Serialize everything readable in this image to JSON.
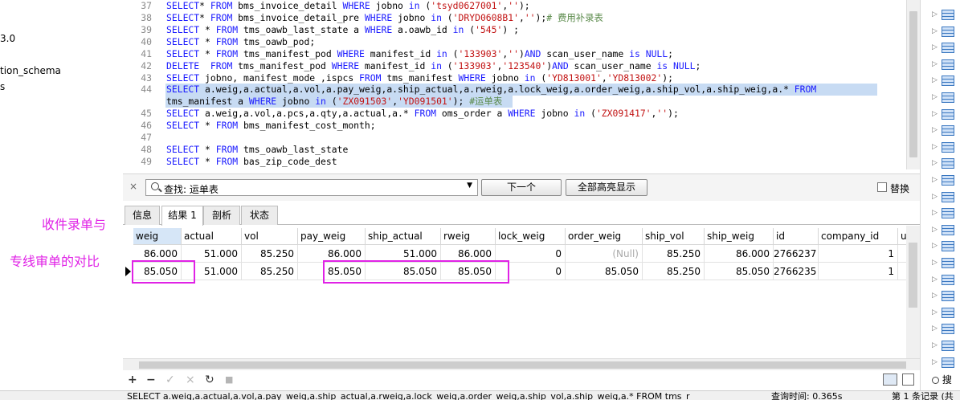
{
  "left_panel": {
    "items": [
      "3.0",
      "tion_schema",
      "s"
    ]
  },
  "annotations": {
    "line1": "收件录单与",
    "line2": "专线审单的对比"
  },
  "editor": {
    "lines": [
      {
        "no": "37",
        "html": "<span class=\"kw\">SELECT</span>* <span class=\"kw\">FROM</span> bms_invoice_detail <span class=\"kw\">WHERE</span> jobno <span class=\"kw\">in</span> (<span class=\"str\">'tsyd0627001'</span>,<span class=\"str\">''</span>);"
      },
      {
        "no": "38",
        "html": "<span class=\"kw\">SELECT</span>* <span class=\"kw\">FROM</span> bms_invoice_detail_pre <span class=\"kw\">WHERE</span> jobno <span class=\"kw\">in</span> (<span class=\"str\">'DRYD0608B1'</span>,<span class=\"str\">''</span>);<span class=\"cmt\"># 费用补录表</span>"
      },
      {
        "no": "39",
        "html": "<span class=\"kw\">SELECT</span> * <span class=\"kw\">FROM</span> tms_oawb_last_state a <span class=\"kw\">WHERE</span> a.oawb_id <span class=\"kw\">in</span> (<span class=\"str\">'545'</span>) ;"
      },
      {
        "no": "40",
        "html": "<span class=\"kw\">SELECT</span> * <span class=\"kw\">FROM</span> tms_oawb_pod;"
      },
      {
        "no": "41",
        "html": "<span class=\"kw\">SELECT</span> * <span class=\"kw\">FROM</span> tms_manifest_pod <span class=\"kw\">WHERE</span> manifest_id <span class=\"kw\">in</span> (<span class=\"str\">'133903'</span>,<span class=\"str\">''</span>)<span class=\"kw\">AND</span> scan_user_name <span class=\"kw\">is</span> <span class=\"kw\">NULL</span>;"
      },
      {
        "no": "42",
        "html": "<span class=\"kw\">DELETE</span>  <span class=\"kw\">FROM</span> tms_manifest_pod <span class=\"kw\">WHERE</span> manifest_id <span class=\"kw\">in</span> (<span class=\"str\">'133903'</span>,<span class=\"str\">'123540'</span>)<span class=\"kw\">AND</span> scan_user_name <span class=\"kw\">is</span> <span class=\"kw\">NULL</span>;"
      },
      {
        "no": "43",
        "html": "<span class=\"kw\">SELECT</span> jobno, manifest_mode ,ispcs <span class=\"kw\">FROM</span> tms_manifest <span class=\"kw\">WHERE</span> jobno <span class=\"kw\">in</span> (<span class=\"str\">'YD813001'</span>,<span class=\"str\">'YD813002'</span>);"
      },
      {
        "no": "44",
        "html": "<span class=\"kw\">SELECT</span> a.weig,a.actual,a.vol,a.pay_weig,a.ship_actual,a.rweig,a.lock_weig,a.order_weig,a.ship_vol,a.ship_weig,a.* <span class=\"kw\">FROM</span>"
      },
      {
        "no": "",
        "html": "tms_manifest a <span class=\"kw\">WHERE</span> jobno <span class=\"kw\">in</span> (<span class=\"str\">'ZX091503'</span>,<span class=\"str\">'YD091501'</span>); <span class=\"cmt\">#运单表</span>"
      },
      {
        "no": "45",
        "html": "<span class=\"kw\">SELECT</span> a.weig,a.vol,a.pcs,a.qty,a.actual,a.* <span class=\"kw\">FROM</span> oms_order a <span class=\"kw\">WHERE</span> jobno <span class=\"kw\">in</span> (<span class=\"str\">'ZX091417'</span>,<span class=\"str\">''</span>);"
      },
      {
        "no": "46",
        "html": "<span class=\"kw\">SELECT</span> * <span class=\"kw\">FROM</span> bms_manifest_cost_month;"
      },
      {
        "no": "47",
        "html": ""
      },
      {
        "no": "48",
        "html": "<span class=\"kw\">SELECT</span> * <span class=\"kw\">FROM</span> tms_oawb_last_state"
      },
      {
        "no": "49",
        "html": "<span class=\"kw\">SELECT</span> * <span class=\"kw\">FROM</span> bas_zip_code_dest"
      }
    ]
  },
  "findbar": {
    "close": "×",
    "query": "查找: 运单表",
    "next_label": "下一个",
    "highlight_all_label": "全部高亮显示",
    "replace_label": "替换"
  },
  "tabs": [
    "信息",
    "结果 1",
    "剖析",
    "状态"
  ],
  "grid": {
    "columns": [
      "weig",
      "actual",
      "vol",
      "pay_weig",
      "ship_actual",
      "rweig",
      "lock_weig",
      "order_weig",
      "ship_vol",
      "ship_weig",
      "id",
      "company_id",
      "u"
    ],
    "rows": [
      [
        "86.000",
        "51.000",
        "85.250",
        "86.000",
        "51.000",
        "86.000",
        "0",
        "(Null)",
        "85.250",
        "86.000",
        "2766237",
        "1",
        ""
      ],
      [
        "85.050",
        "51.000",
        "85.250",
        "85.050",
        "85.050",
        "85.050",
        "0",
        "85.050",
        "85.250",
        "85.050",
        "2766235",
        "1",
        ""
      ]
    ]
  },
  "toolbar": {
    "icons": [
      "+",
      "−",
      "✓",
      "×",
      "↻",
      "■"
    ]
  },
  "right_panel": {
    "search_label": "搜"
  },
  "status": {
    "sql": "SELECT a.weig,a.actual,a.vol,a.pay_weig,a.ship_actual,a.rweig,a.lock_weig,a.order_weig,a.ship_vol,a.ship_weig,a.* FROM tms_r",
    "query_time": "查询时间: 0.365s",
    "record": "第 1 条记录 (共"
  },
  "colors": {
    "annotation": "#e022e6",
    "selection": "#c7dbf3",
    "keyword": "#1a1aff",
    "string": "#c21313",
    "comment": "#5a8a4a"
  }
}
